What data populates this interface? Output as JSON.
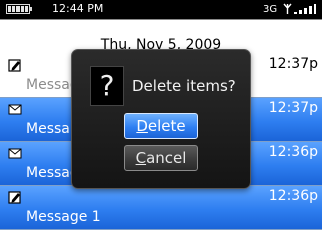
{
  "status_bar": {
    "time": "12:44 PM",
    "network": "3G",
    "battery_icon": "battery-icon",
    "antenna_icon": "antenna-icon",
    "signal_icon": "signal-strength-icon"
  },
  "message_list": {
    "date_header": "Thu, Nov 5, 2009",
    "rows": [
      {
        "icon": "draft-pencil-icon",
        "time": "12:37p",
        "subject": "Messag",
        "selected": false
      },
      {
        "icon": "envelope-icon",
        "time": "12:37p",
        "subject": "Messa",
        "selected": true
      },
      {
        "icon": "envelope-icon",
        "time": "12:36p",
        "subject": "Messag",
        "selected": true
      },
      {
        "icon": "draft-pencil-icon",
        "time": "12:36p",
        "subject": "Message 1",
        "selected": true
      }
    ]
  },
  "dialog": {
    "icon": "question-icon",
    "icon_glyph": "?",
    "message": "Delete items?",
    "delete_button": {
      "mnemonic": "D",
      "rest": "elete"
    },
    "cancel_button": {
      "mnemonic": "C",
      "rest": "ancel"
    }
  },
  "colors": {
    "selection_blue": "#2e7ef0",
    "dialog_background": "#1c1c1c",
    "status_bar": "#000000"
  }
}
